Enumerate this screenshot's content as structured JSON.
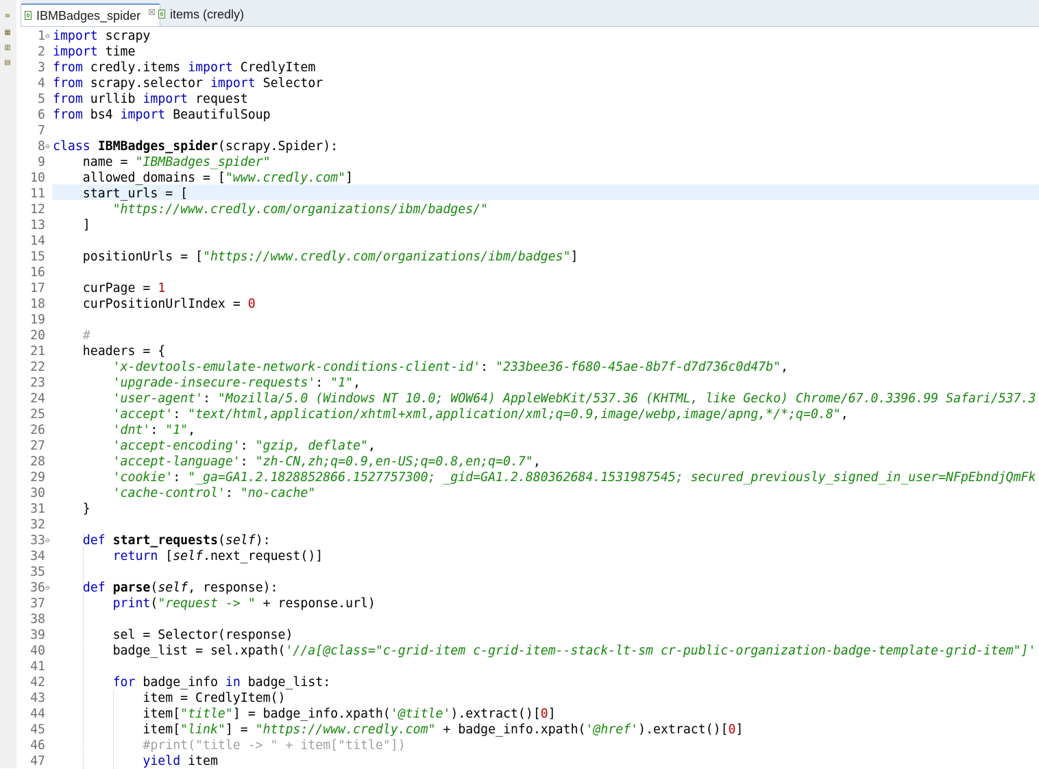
{
  "tabs": [
    {
      "label": "IBMBadges_spider",
      "close": "☒",
      "active": true
    },
    {
      "label": "items (credly)",
      "active": false
    }
  ],
  "left_icons": [
    "outline-icon",
    "package-icon",
    "hierarchy-icon",
    "members-icon"
  ],
  "fold_markers": {
    "1": "⊖",
    "8": "⊖",
    "33": "⊖",
    "36": "⊖"
  },
  "current_line": 11,
  "code_lines": [
    [
      [
        "kw",
        "import"
      ],
      [
        "p",
        " scrapy"
      ]
    ],
    [
      [
        "kw",
        "import"
      ],
      [
        "p",
        " time"
      ]
    ],
    [
      [
        "kw",
        "from"
      ],
      [
        "p",
        " credly.items "
      ],
      [
        "kw",
        "import"
      ],
      [
        "p",
        " CredlyItem"
      ]
    ],
    [
      [
        "kw",
        "from"
      ],
      [
        "p",
        " scrapy.selector "
      ],
      [
        "kw",
        "import"
      ],
      [
        "p",
        " Selector"
      ]
    ],
    [
      [
        "kw",
        "from"
      ],
      [
        "p",
        " urllib "
      ],
      [
        "kw",
        "import"
      ],
      [
        "p",
        " request"
      ]
    ],
    [
      [
        "kw",
        "from"
      ],
      [
        "p",
        " bs4 "
      ],
      [
        "kw",
        "import"
      ],
      [
        "p",
        " BeautifulSoup"
      ]
    ],
    [],
    [
      [
        "kw",
        "class"
      ],
      [
        "p",
        " "
      ],
      [
        "fn",
        "IBMBadges_spider"
      ],
      [
        "p",
        "(scrapy.Spider):"
      ]
    ],
    [
      [
        "p",
        "    name = "
      ],
      [
        "str",
        "\"IBMBadges_spider\""
      ]
    ],
    [
      [
        "p",
        "    allowed_domains = ["
      ],
      [
        "str",
        "\"www.credly.com\""
      ],
      [
        "p",
        "]"
      ]
    ],
    [
      [
        "p",
        "    start_urls = ["
      ]
    ],
    [
      [
        "p",
        "        "
      ],
      [
        "str",
        "\"https://www.credly.com/organizations/ibm/badges/\""
      ]
    ],
    [
      [
        "p",
        "    ]"
      ]
    ],
    [],
    [
      [
        "p",
        "    positionUrls = ["
      ],
      [
        "str",
        "\"https://www.credly.com/organizations/ibm/badges\""
      ],
      [
        "p",
        "]"
      ]
    ],
    [],
    [
      [
        "p",
        "    curPage = "
      ],
      [
        "num",
        "1"
      ]
    ],
    [
      [
        "p",
        "    curPositionUrlIndex = "
      ],
      [
        "num",
        "0"
      ]
    ],
    [],
    [
      [
        "p",
        "    "
      ],
      [
        "cm",
        "#"
      ]
    ],
    [
      [
        "p",
        "    headers = {"
      ]
    ],
    [
      [
        "p",
        "        "
      ],
      [
        "str",
        "'x-devtools-emulate-network-conditions-client-id'"
      ],
      [
        "p",
        ": "
      ],
      [
        "str",
        "\"233bee36-f680-45ae-8b7f-d7d736c0d47b\""
      ],
      [
        "p",
        ","
      ]
    ],
    [
      [
        "p",
        "        "
      ],
      [
        "str",
        "'upgrade-insecure-requests'"
      ],
      [
        "p",
        ": "
      ],
      [
        "str",
        "\"1\""
      ],
      [
        "p",
        ","
      ]
    ],
    [
      [
        "p",
        "        "
      ],
      [
        "str",
        "'user-agent'"
      ],
      [
        "p",
        ": "
      ],
      [
        "str",
        "\"Mozilla/5.0 (Windows NT 10.0; WOW64) AppleWebKit/537.36 (KHTML, like Gecko) Chrome/67.0.3396.99 Safari/537.3"
      ]
    ],
    [
      [
        "p",
        "        "
      ],
      [
        "str",
        "'accept'"
      ],
      [
        "p",
        ": "
      ],
      [
        "str",
        "\"text/html,application/xhtml+xml,application/xml;q=0.9,image/webp,image/apng,*/*;q=0.8\""
      ],
      [
        "p",
        ","
      ]
    ],
    [
      [
        "p",
        "        "
      ],
      [
        "str",
        "'dnt'"
      ],
      [
        "p",
        ": "
      ],
      [
        "str",
        "\"1\""
      ],
      [
        "p",
        ","
      ]
    ],
    [
      [
        "p",
        "        "
      ],
      [
        "str",
        "'accept-encoding'"
      ],
      [
        "p",
        ": "
      ],
      [
        "str",
        "\"gzip, deflate\""
      ],
      [
        "p",
        ","
      ]
    ],
    [
      [
        "p",
        "        "
      ],
      [
        "str",
        "'accept-language'"
      ],
      [
        "p",
        ": "
      ],
      [
        "str",
        "\"zh-CN,zh;q=0.9,en-US;q=0.8,en;q=0.7\""
      ],
      [
        "p",
        ","
      ]
    ],
    [
      [
        "p",
        "        "
      ],
      [
        "str",
        "'cookie'"
      ],
      [
        "p",
        ": "
      ],
      [
        "str",
        "\"_ga=GA1.2.1828852866.1527757300; _gid=GA1.2.880362684.1531987545; secured_previously_signed_in_user=NFpEbndjQmFk"
      ]
    ],
    [
      [
        "p",
        "        "
      ],
      [
        "str",
        "'cache-control'"
      ],
      [
        "p",
        ": "
      ],
      [
        "str",
        "\"no-cache\""
      ]
    ],
    [
      [
        "p",
        "    }"
      ]
    ],
    [],
    [
      [
        "p",
        "    "
      ],
      [
        "kw",
        "def"
      ],
      [
        "p",
        " "
      ],
      [
        "fn",
        "start_requests"
      ],
      [
        "p",
        "("
      ],
      [
        "it",
        "self"
      ],
      [
        "p",
        "):"
      ]
    ],
    [
      [
        "p",
        "        "
      ],
      [
        "kw",
        "return"
      ],
      [
        "p",
        " ["
      ],
      [
        "it",
        "self"
      ],
      [
        "p",
        ".next_request()]"
      ]
    ],
    [],
    [
      [
        "p",
        "    "
      ],
      [
        "kw",
        "def"
      ],
      [
        "p",
        " "
      ],
      [
        "fn",
        "parse"
      ],
      [
        "p",
        "("
      ],
      [
        "it",
        "self"
      ],
      [
        "p",
        ", response):"
      ]
    ],
    [
      [
        "p",
        "        "
      ],
      [
        "kw",
        "print"
      ],
      [
        "p",
        "("
      ],
      [
        "str",
        "\"request -> \""
      ],
      [
        "p",
        " + response.url)"
      ]
    ],
    [],
    [
      [
        "p",
        "        sel = Selector(response)"
      ]
    ],
    [
      [
        "p",
        "        badge_list = sel.xpath("
      ],
      [
        "str",
        "'//a[@class=\"c-grid-item c-grid-item--stack-lt-sm cr-public-organization-badge-template-grid-item\"]'"
      ]
    ],
    [],
    [
      [
        "p",
        "        "
      ],
      [
        "kw",
        "for"
      ],
      [
        "p",
        " badge_info "
      ],
      [
        "kw",
        "in"
      ],
      [
        "p",
        " badge_list:"
      ]
    ],
    [
      [
        "p",
        "            item = CredlyItem()"
      ]
    ],
    [
      [
        "p",
        "            item["
      ],
      [
        "str",
        "\"title\""
      ],
      [
        "p",
        "] = badge_info.xpath("
      ],
      [
        "str",
        "'@title'"
      ],
      [
        "p",
        ").extract()["
      ],
      [
        "num",
        "0"
      ],
      [
        "p",
        "]"
      ]
    ],
    [
      [
        "p",
        "            item["
      ],
      [
        "str",
        "\"link\""
      ],
      [
        "p",
        "] = "
      ],
      [
        "str",
        "\"https://www.credly.com\""
      ],
      [
        "p",
        " + badge_info.xpath("
      ],
      [
        "str",
        "'@href'"
      ],
      [
        "p",
        ").extract()["
      ],
      [
        "num",
        "0"
      ],
      [
        "p",
        "]"
      ]
    ],
    [
      [
        "p",
        "            "
      ],
      [
        "cm",
        "#print(\"title -> \" + item[\"title\"])"
      ]
    ],
    [
      [
        "p",
        "            "
      ],
      [
        "kw",
        "yield"
      ],
      [
        "p",
        " item"
      ]
    ]
  ]
}
